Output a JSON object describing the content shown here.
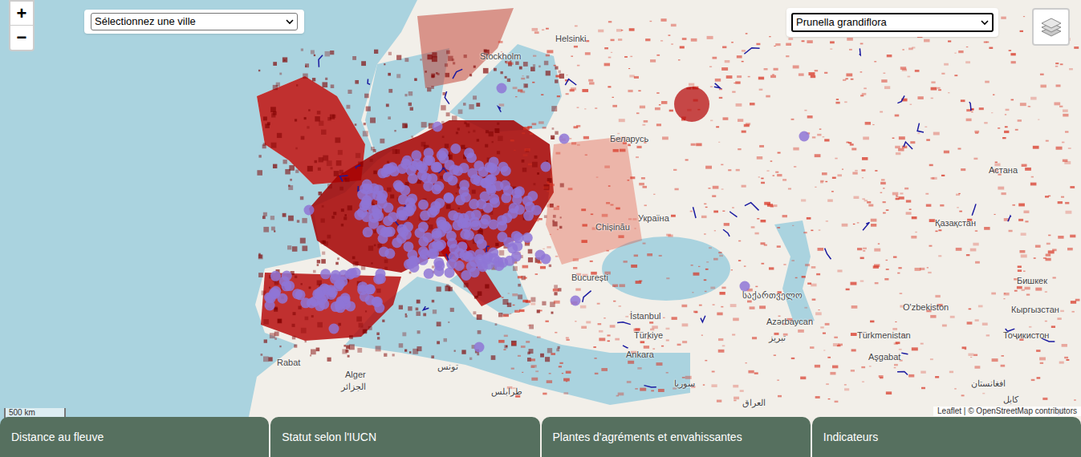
{
  "controls": {
    "zoom_in": "+",
    "zoom_out": "−",
    "city_select": {
      "value": "Sélectionnez une ville"
    },
    "species_select": {
      "value": "Prunella grandiflora"
    }
  },
  "map": {
    "labels": [
      "Helsinki",
      "Stockholm",
      "Беларусь",
      "Україна",
      "Chișinău",
      "București",
      "İstanbul",
      "Türkiye",
      "Ankara",
      "Астана",
      "Қазақстан",
      "Бишкек",
      "O'zbekiston",
      "Кыргызстан",
      "Türkmenistan",
      "Aşgabat",
      "Тоҷикистон",
      "Azərbaycan",
      "საქართველო",
      "تبریز",
      "سوريا",
      "العراق",
      "Alger",
      "الجزائر",
      "تونس",
      "طرابلس",
      "Rabat",
      "افغانستان",
      "کابل"
    ],
    "scale": "500 km",
    "attribution": "Leaflet | © OpenStreetMap contributors"
  },
  "tabs": [
    {
      "label": "Distance au fleuve",
      "selected": false
    },
    {
      "label": "Statut selon l'IUCN",
      "selected": false
    },
    {
      "label": "Plantes d'agréments et envahissantes",
      "selected": false
    },
    {
      "label": "Indicateurs",
      "selected": false
    }
  ]
}
